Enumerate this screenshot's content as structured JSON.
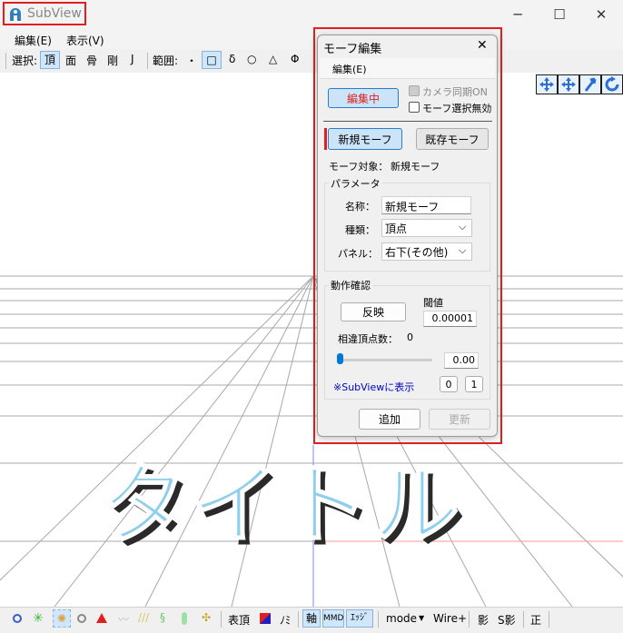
{
  "window": {
    "title": "SubView",
    "controls": {
      "minimize": "─",
      "maximize": "☐",
      "close": "✕"
    }
  },
  "menu": [
    "編集(E)",
    "表示(V)"
  ],
  "toolbar": {
    "select_label": "選択:",
    "select_items": [
      "頂",
      "面",
      "骨",
      "剛",
      "J"
    ],
    "range_label": "範囲:",
    "range_items": [
      "・",
      "□",
      "δ",
      "○",
      "△",
      "Φ"
    ],
    "right_icons": [
      "move-all-icon",
      "move-cross-icon",
      "rotate-arrow-icon",
      "rotate-circle-icon"
    ]
  },
  "viewport": {
    "watermark": "タイトル",
    "colors": {
      "grid": "#9a9a9a",
      "text_fill": "#8ecfee",
      "text_shadow": "#2a2a2a",
      "x_axis": "#ff9a9a",
      "y_axis": "#7a8aff"
    }
  },
  "bottombar": {
    "labels": [
      "表頂",
      "ﾉﾐ",
      "軸",
      "MMD",
      "ｴｯｼﾞ",
      "mode",
      "Wire+",
      "影",
      "S影",
      "正"
    ]
  },
  "dialog": {
    "title": "モーフ編集",
    "close": "✕",
    "menu": "編集(E)",
    "edit_button": "編集中",
    "camera_sync": "カメラ同期ON",
    "disable_morph_select": "モーフ選択無効",
    "new_morph_button": "新規モーフ",
    "existing_morph_button": "既存モーフ",
    "target_label": "モーフ対象：",
    "target_value": "新規モーフ",
    "params": {
      "title": "パラメータ",
      "name_label": "名称：",
      "name_value": "新規モーフ",
      "type_label": "種類：",
      "type_value": "頂点",
      "panel_label": "パネル：",
      "panel_value": "右下(その他)"
    },
    "check": {
      "title": "動作確認",
      "threshold_label": "閾値",
      "flip_button": "反映",
      "threshold_value": "0.00001",
      "diff_label": "相違頂点数：",
      "diff_value": "0",
      "slider_value": "0.00",
      "slider_fraction": 0,
      "subview_link": "※SubViewに表示",
      "btn0": "0",
      "btn1": "1"
    },
    "add_button": "追加",
    "update_button": "更新"
  }
}
